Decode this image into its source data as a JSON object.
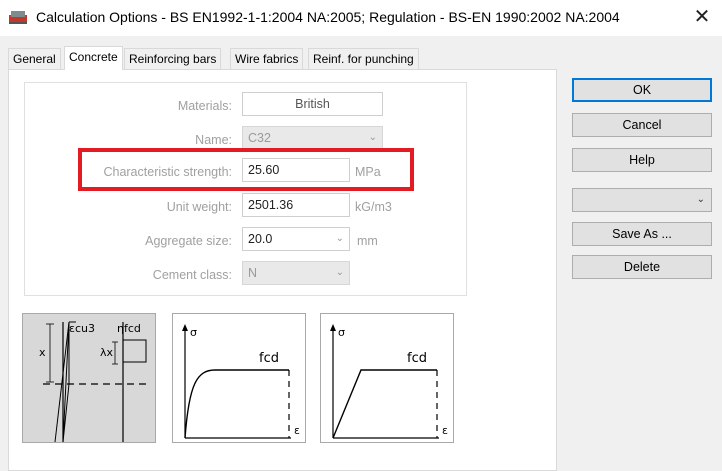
{
  "window": {
    "title": "Calculation Options - BS EN1992-1-1:2004 NA:2005;   Regulation - BS-EN 1990:2002 NA:2004",
    "close_glyph": "✕"
  },
  "tabs": [
    {
      "label": "General"
    },
    {
      "label": "Concrete"
    },
    {
      "label": "Reinforcing bars"
    },
    {
      "label": "Wire fabrics"
    },
    {
      "label": "Reinf. for punching"
    }
  ],
  "active_tab": "Concrete",
  "form": {
    "materials": {
      "label": "Materials:",
      "value": "British"
    },
    "name": {
      "label": "Name:",
      "value": "C32"
    },
    "char_strength": {
      "label": "Characteristic strength:",
      "value": "25.60",
      "unit": "MPa"
    },
    "unit_weight": {
      "label": "Unit weight:",
      "value": "2501.36",
      "unit": "kG/m3"
    },
    "aggregate_size": {
      "label": "Aggregate size:",
      "value": "20.0",
      "unit": "mm"
    },
    "cement_class": {
      "label": "Cement class:",
      "value": "N"
    }
  },
  "diagrams": {
    "rect": {
      "ecu3": "εcu3",
      "x": "x",
      "lx": "λx",
      "eta_fcd": "ηfcd"
    },
    "parabolic": {
      "sigma": "σ",
      "fcd": "fcd",
      "eps": "ε"
    },
    "bilinear": {
      "sigma": "σ",
      "fcd": "fcd",
      "eps": "ε"
    }
  },
  "buttons": {
    "ok": "OK",
    "cancel": "Cancel",
    "help": "Help",
    "save_as": "Save As ...",
    "delete": "Delete"
  },
  "preset_combo": {
    "value": ""
  },
  "colors": {
    "highlight": "#e31b23",
    "default_button_border": "#0078d7"
  },
  "icons": {
    "chevron": "chevron-down-icon",
    "close": "close-icon",
    "app": "app-icon"
  }
}
